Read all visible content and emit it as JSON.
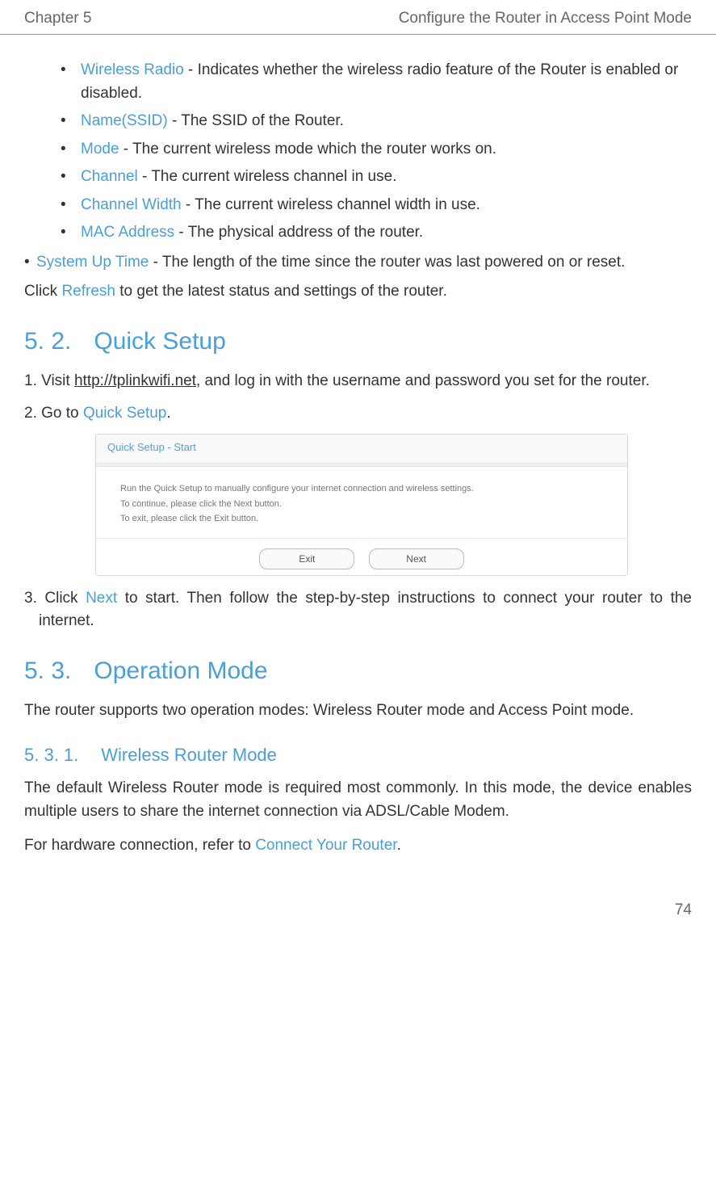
{
  "header": {
    "chapter": "Chapter 5",
    "title": "Configure the Router in Access Point Mode"
  },
  "bullets": {
    "wireless_radio": {
      "term": "Wireless Radio",
      "desc": " - Indicates whether the wireless radio feature of the Router is enabled or disabled."
    },
    "name_ssid": {
      "term": "Name(SSID)",
      "desc": " - The SSID of the Router."
    },
    "mode": {
      "term": "Mode",
      "desc": " - The current wireless mode which the router works on."
    },
    "channel": {
      "term": "Channel",
      "desc": " - The current wireless channel in use."
    },
    "channel_width": {
      "term": "Channel Width",
      "desc": " - The current wireless channel width in use."
    },
    "mac_address": {
      "term": "MAC Address",
      "desc": " - The physical address of the router."
    }
  },
  "system_uptime": {
    "term": "System Up Time",
    "desc": " - The length of the time since the router was last powered on or reset."
  },
  "refresh_line": {
    "pre": "Click ",
    "term": "Refresh",
    "post": " to get the latest status and settings of the router."
  },
  "s52": {
    "num": "5. 2.",
    "title": "Quick Setup",
    "step1": {
      "pre": "1. Visit ",
      "link": "http://tplinkwifi.net",
      "post": ", and log in with the username and password you set for the router."
    },
    "step2": {
      "pre": "2. Go to ",
      "term": "Quick Setup",
      "post": "."
    },
    "step3": {
      "pre": "3. Click ",
      "term": "Next",
      "post": " to start. Then follow the step-by-step instructions to connect your router to the internet."
    }
  },
  "screenshot": {
    "title": "Quick Setup - Start",
    "line1": "Run the Quick Setup to manually configure your internet connection and wireless settings.",
    "line2a": "To continue, please click the ",
    "line2b": "Next",
    "line2c": " button.",
    "line3a": "To exit, please click the ",
    "line3b": "Exit",
    "line3c": " button.",
    "btn_exit": "Exit",
    "btn_next": "Next"
  },
  "s53": {
    "num": "5. 3.",
    "title": "Operation Mode",
    "intro": "The router supports two operation modes: Wireless Router mode and Access Point mode."
  },
  "s531": {
    "num": "5. 3. 1.",
    "title": "Wireless Router Mode",
    "p1": "The default Wireless Router mode is required most commonly. In this mode, the device enables multiple users to share the internet connection via ADSL/Cable Modem.",
    "p2": {
      "pre": "For hardware connection, refer to ",
      "term": "Connect Your Router",
      "post": "."
    }
  },
  "page_num": "74"
}
